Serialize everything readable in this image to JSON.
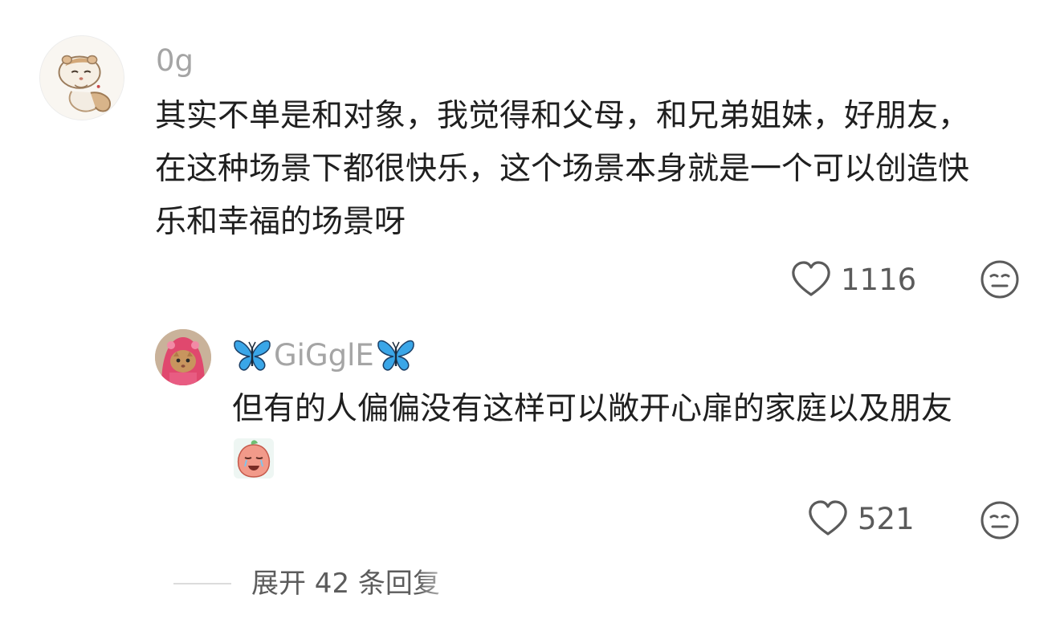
{
  "main_comment": {
    "username": "0g",
    "text": "其实不单是和对象，我觉得和父母，和兄弟姐妹，好朋友，在这种场景下都很快乐，这个场景本身就是一个可以创造快乐和幸福的场景呀",
    "like_count": "1116",
    "avatar_icon": "hamster-cartoon-avatar",
    "like_icon": "heart-outline-icon",
    "dislike_icon": "meh-face-icon"
  },
  "reply_comment": {
    "username": "GiGglE",
    "username_decoration_icon": "blue-butterfly-icon",
    "text": "但有的人偏偏没有这样可以敞开心扉的家庭以及朋友",
    "sticker_icon": "crying-peach-sticker-icon",
    "like_count": "521",
    "avatar_icon": "cat-in-pink-hood-avatar",
    "like_icon": "heart-outline-icon",
    "dislike_icon": "meh-face-icon"
  },
  "expand_replies": {
    "label": "展开 42 条回复"
  },
  "colors": {
    "text_primary": "#1f1f1f",
    "username": "#a5a5a5",
    "action": "#5b5b5b",
    "butterfly": "#3aa6e8"
  }
}
